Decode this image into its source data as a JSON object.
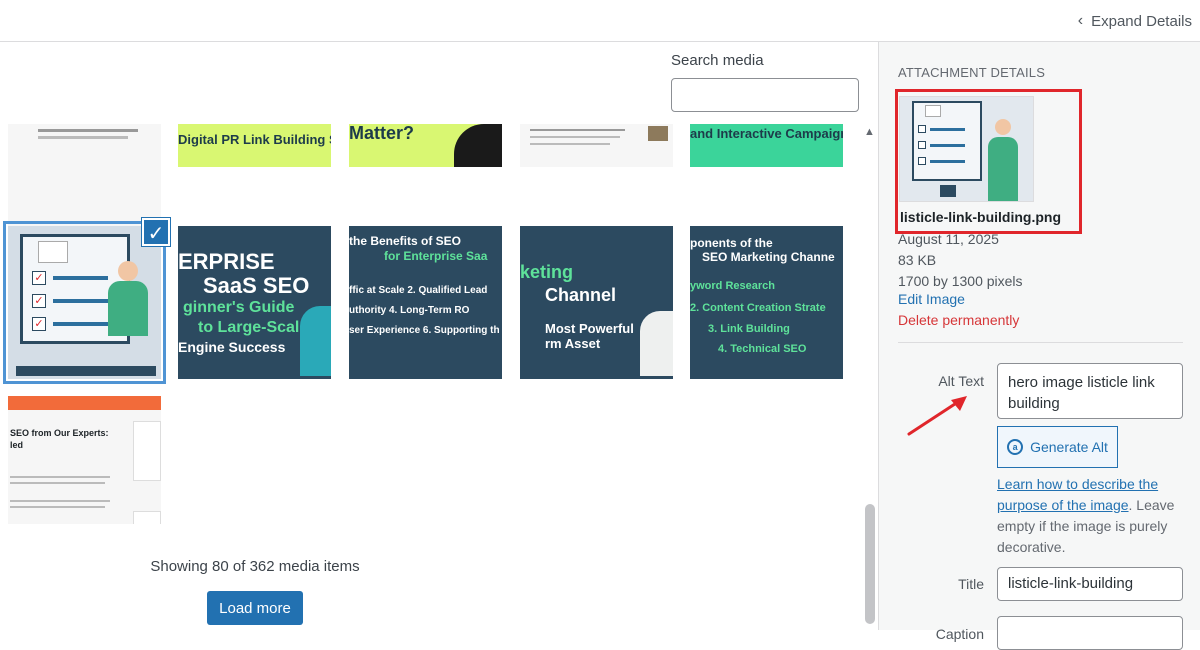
{
  "header": {
    "expand_label": "Expand Details"
  },
  "search": {
    "label": "Search media",
    "value": "",
    "placeholder": ""
  },
  "grid": {
    "row1": [
      {
        "text": ""
      },
      {
        "text": "Digital PR Link Building Strateg"
      },
      {
        "text": "Matter?"
      },
      {
        "text": ""
      },
      {
        "text": "and Interactive Campaign"
      }
    ],
    "row2": [
      {
        "text": ""
      },
      {
        "line1": "ERPRISE",
        "line2": "SaaS SEO",
        "line3": "ginner's Guide",
        "line4": "to Large-Scale",
        "line5": "Engine Success"
      },
      {
        "line1": "the Benefits of SEO",
        "line2": "for Enterprise Saa",
        "line3": "ffic at Scale   2. Qualified Lead",
        "line4": "uthority   4. Long-Term RO",
        "line5": "ser Experience   6. Supporting th"
      },
      {
        "line1": "keting",
        "line2": "Channel",
        "line3": "Most Powerful",
        "line4": "rm Asset"
      },
      {
        "line1": "ponents of the",
        "line2": "SEO Marketing Channe",
        "line3": "yword Research",
        "line4": "2. Content Creation Strate",
        "line5": "3. Link Building",
        "line6": "4. Technical SEO"
      }
    ],
    "row3": [
      {
        "line1": "SEO from Our Experts:",
        "line2": "led"
      }
    ]
  },
  "status": {
    "showing": "Showing 80 of 362 media items"
  },
  "buttons": {
    "load_more": "Load more",
    "generate_alt": "Generate Alt"
  },
  "details": {
    "heading": "ATTACHMENT DETAILS",
    "filename": "listicle-link-building.png",
    "date": "August 11, 2025",
    "size": "83 KB",
    "dimensions": "1700 by 1300 pixels",
    "edit_image": "Edit Image",
    "delete": "Delete permanently"
  },
  "fields": {
    "alt_label": "Alt Text",
    "alt_value": "hero image listicle link building",
    "help_link": "Learn how to describe the purpose of the image",
    "help_rest": ". Leave empty if the image is purely decorative.",
    "title_label": "Title",
    "title_value": "listicle-link-building",
    "caption_label": "Caption"
  },
  "colors": {
    "accent": "#2271b1",
    "highlight": "#e0262b",
    "danger": "#d63638"
  }
}
